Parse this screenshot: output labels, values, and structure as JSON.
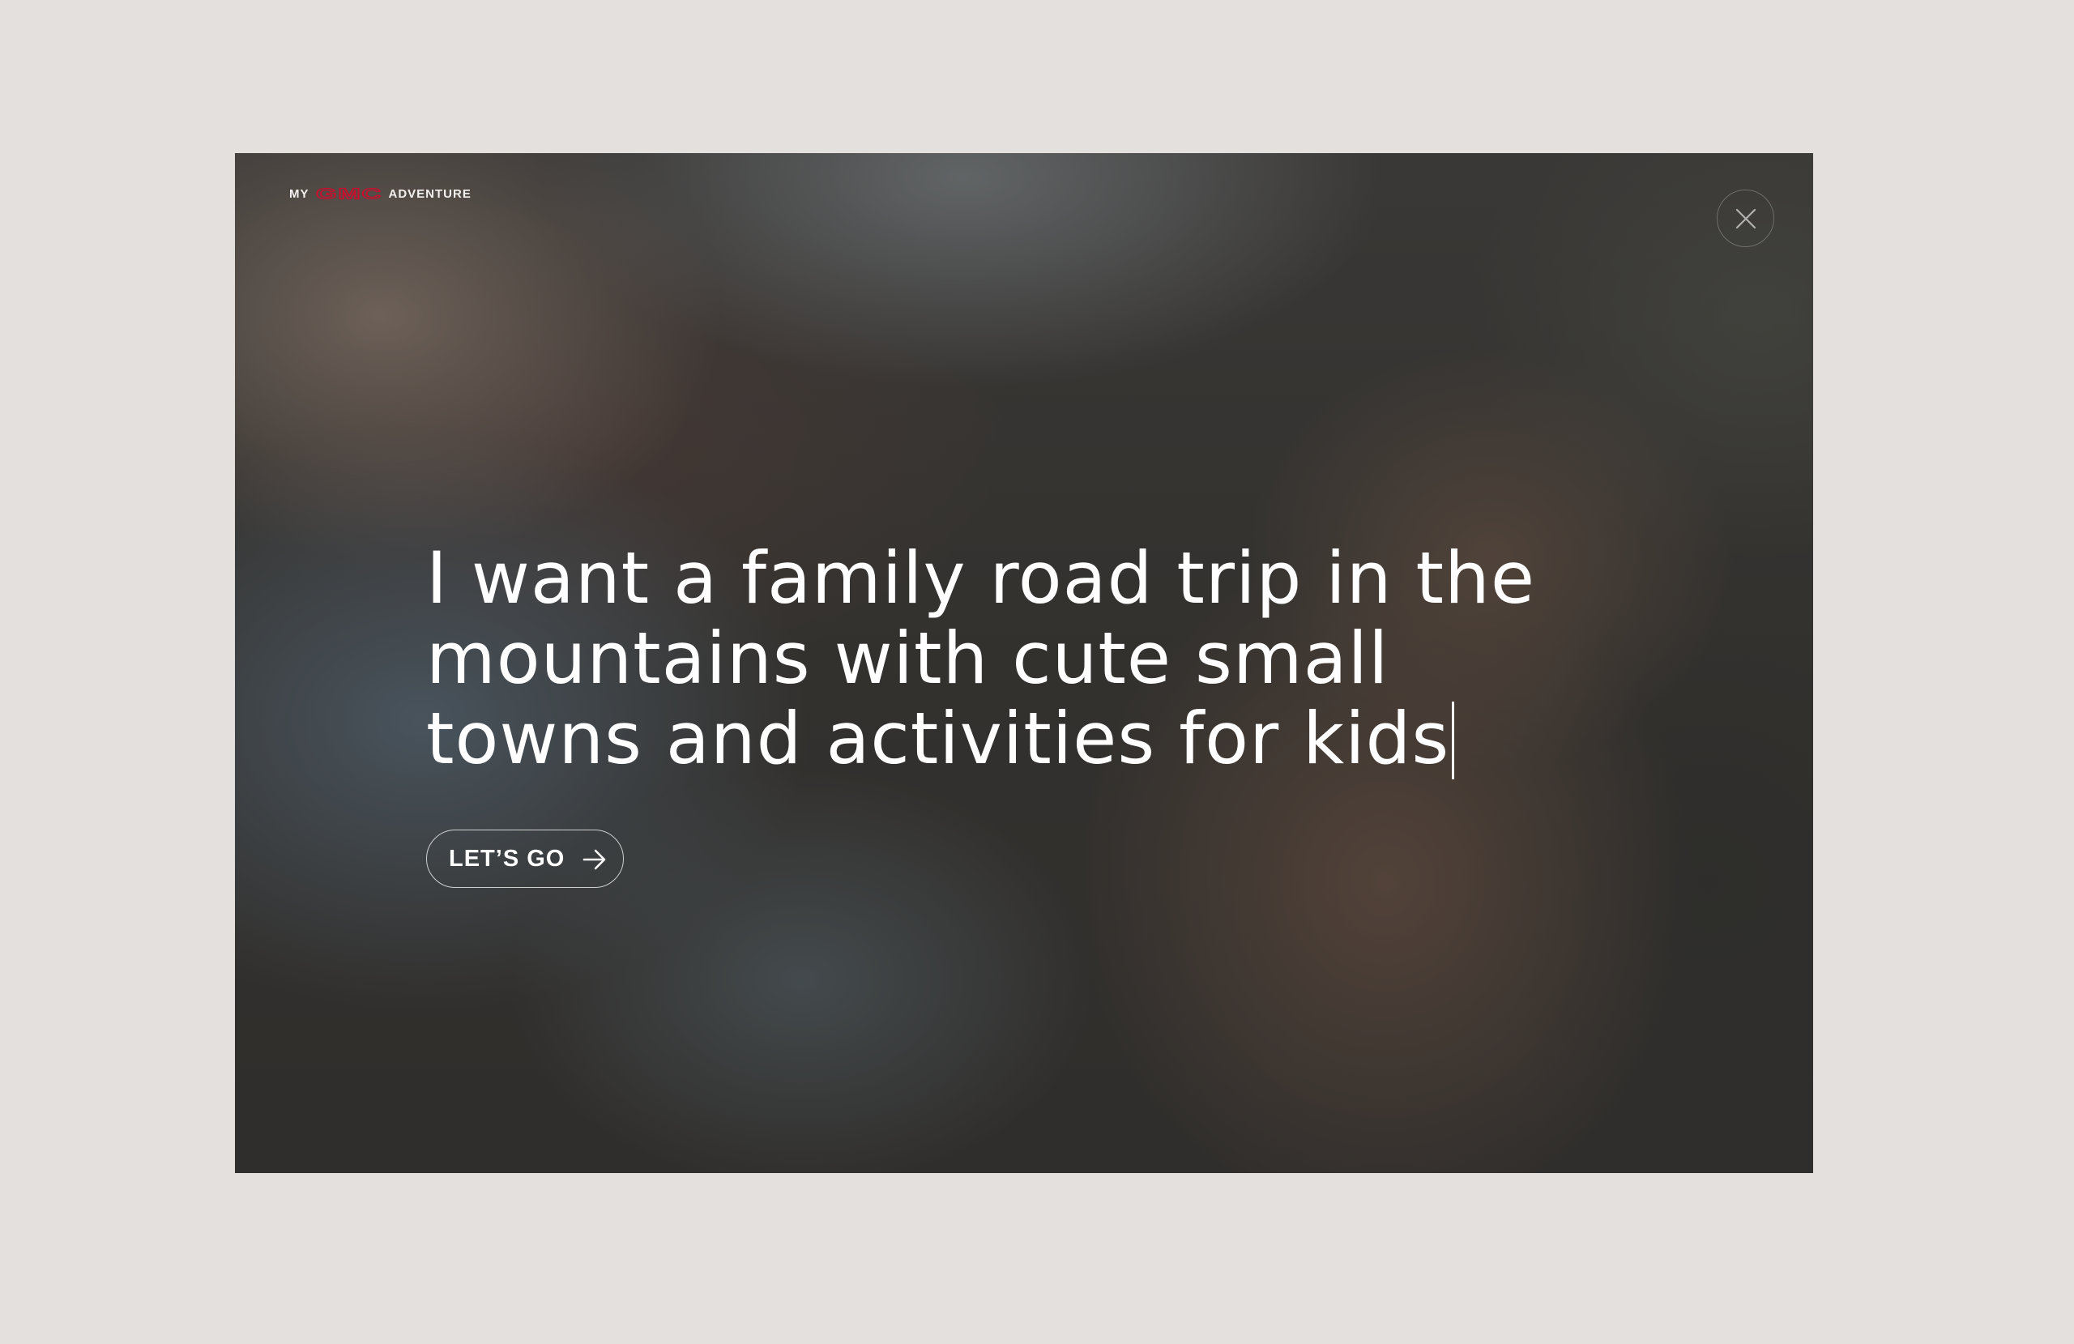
{
  "modal": {
    "brand_prefix": "MY",
    "brand_logo": "GMC",
    "brand_suffix": "ADVENTURE",
    "prompt_text": "I want a family road trip in the mountains with cute small towns and activities for kids",
    "cta_label": "LET’S GO",
    "close_icon": "close-icon",
    "cta_icon": "arrow-right-icon"
  },
  "colors": {
    "page_background": "#e4e0dd",
    "brand_red": "#c8102e",
    "text": "#ffffff"
  }
}
